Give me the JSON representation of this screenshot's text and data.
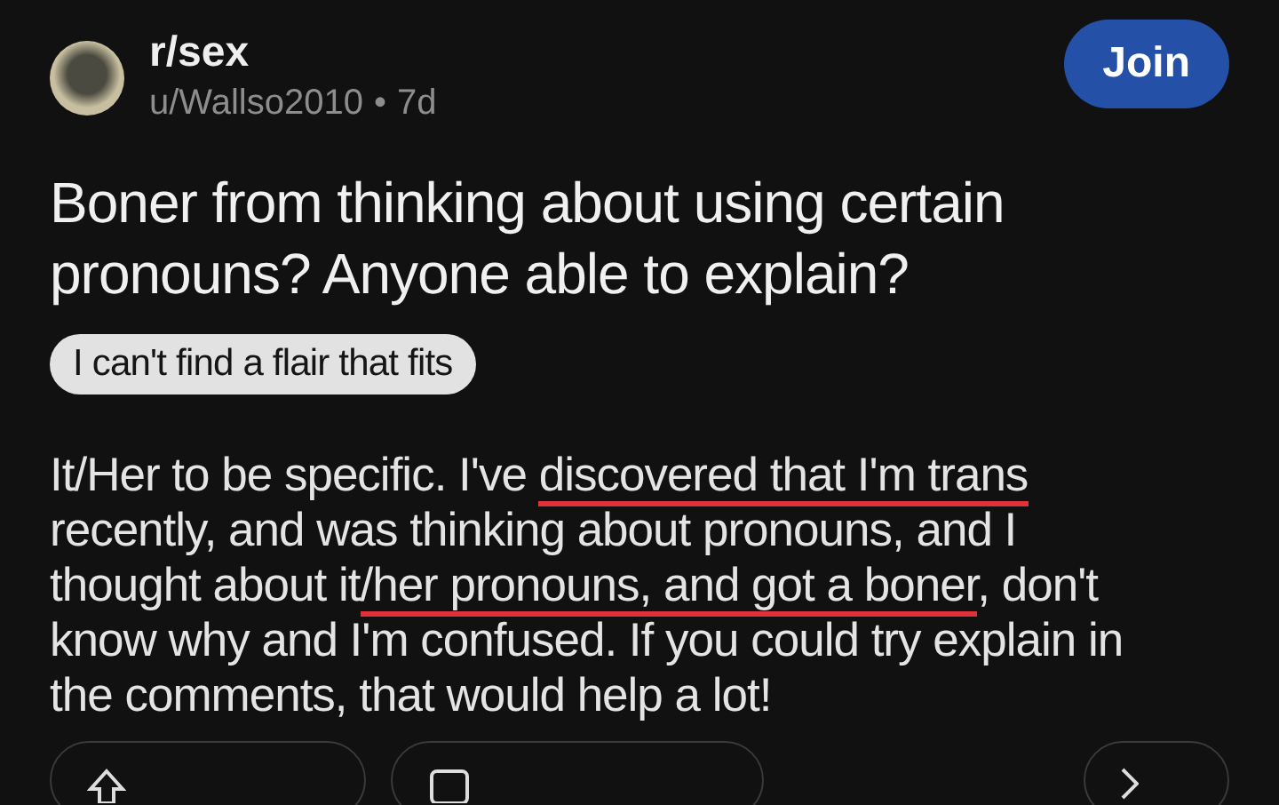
{
  "header": {
    "community": "r/sex",
    "author": "u/Wallso2010",
    "separator": "•",
    "age": "7d",
    "join_button": "Join"
  },
  "title": "Boner from thinking about using certain pronouns? Anyone able to explain?",
  "flair": "I can't find a flair that fits",
  "body_lines": [
    [
      {
        "text": "It/Her to be specific. I've ",
        "underlined": false
      },
      {
        "text": "discovered that I'm trans",
        "underlined": true
      }
    ],
    [
      {
        "text": "recently, and was thinking about pronouns, and I",
        "underlined": false
      }
    ],
    [
      {
        "text": "thought about it",
        "underlined": false
      },
      {
        "text": "/her pronouns, and got a boner",
        "underlined": true
      },
      {
        "text": ", don't",
        "underlined": false
      }
    ],
    [
      {
        "text": "know why and I'm confused. If you could try explain in",
        "underlined": false
      }
    ],
    [
      {
        "text": "the comments, that would help a lot!",
        "underlined": false
      }
    ]
  ]
}
